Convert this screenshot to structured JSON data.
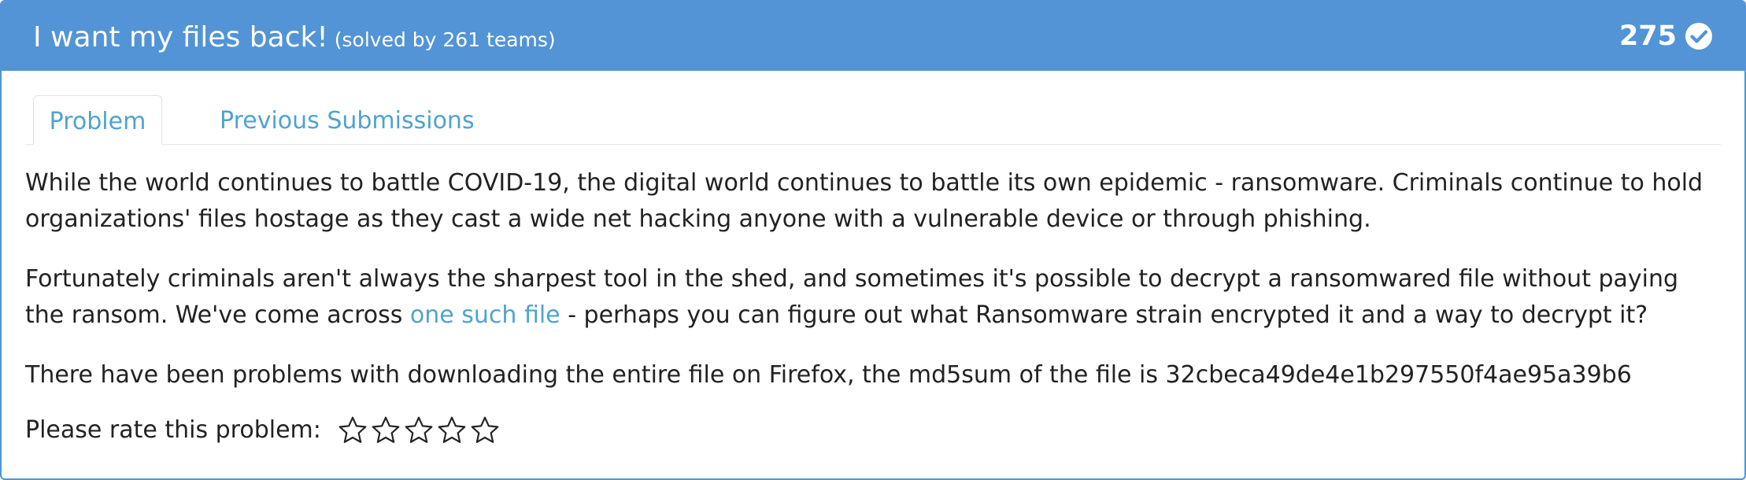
{
  "header": {
    "title": "I want my files back!",
    "subtitle": "(solved by 261 teams)",
    "points": "275",
    "accent_color": "#5294d6",
    "solved_icon": "check-circle-icon"
  },
  "tabs": [
    {
      "label": "Problem",
      "active": true
    },
    {
      "label": "Previous Submissions",
      "active": false
    }
  ],
  "problem": {
    "paragraph1": "While the world continues to battle COVID-19, the digital world continues to battle its own epidemic - ransomware. Criminals continue to hold organizations' files hostage as they cast a wide net hacking anyone with a vulnerable device or through phishing.",
    "paragraph2_before": "Fortunately criminals aren't always the sharpest tool in the shed, and sometimes it's possible to decrypt a ransomwared file without paying the ransom. We've come across ",
    "paragraph2_link": "one such file",
    "paragraph2_after": " - perhaps you can figure out what Ransomware strain encrypted it and a way to decrypt it?",
    "paragraph3": "There have been problems with downloading the entire file on Firefox, the md5sum of the file is 32cbeca49de4e1b297550f4ae95a39b6"
  },
  "rating": {
    "label": "Please rate this problem:",
    "max_stars": 5,
    "filled_stars": 0,
    "star_icon": "star-outline-icon"
  }
}
